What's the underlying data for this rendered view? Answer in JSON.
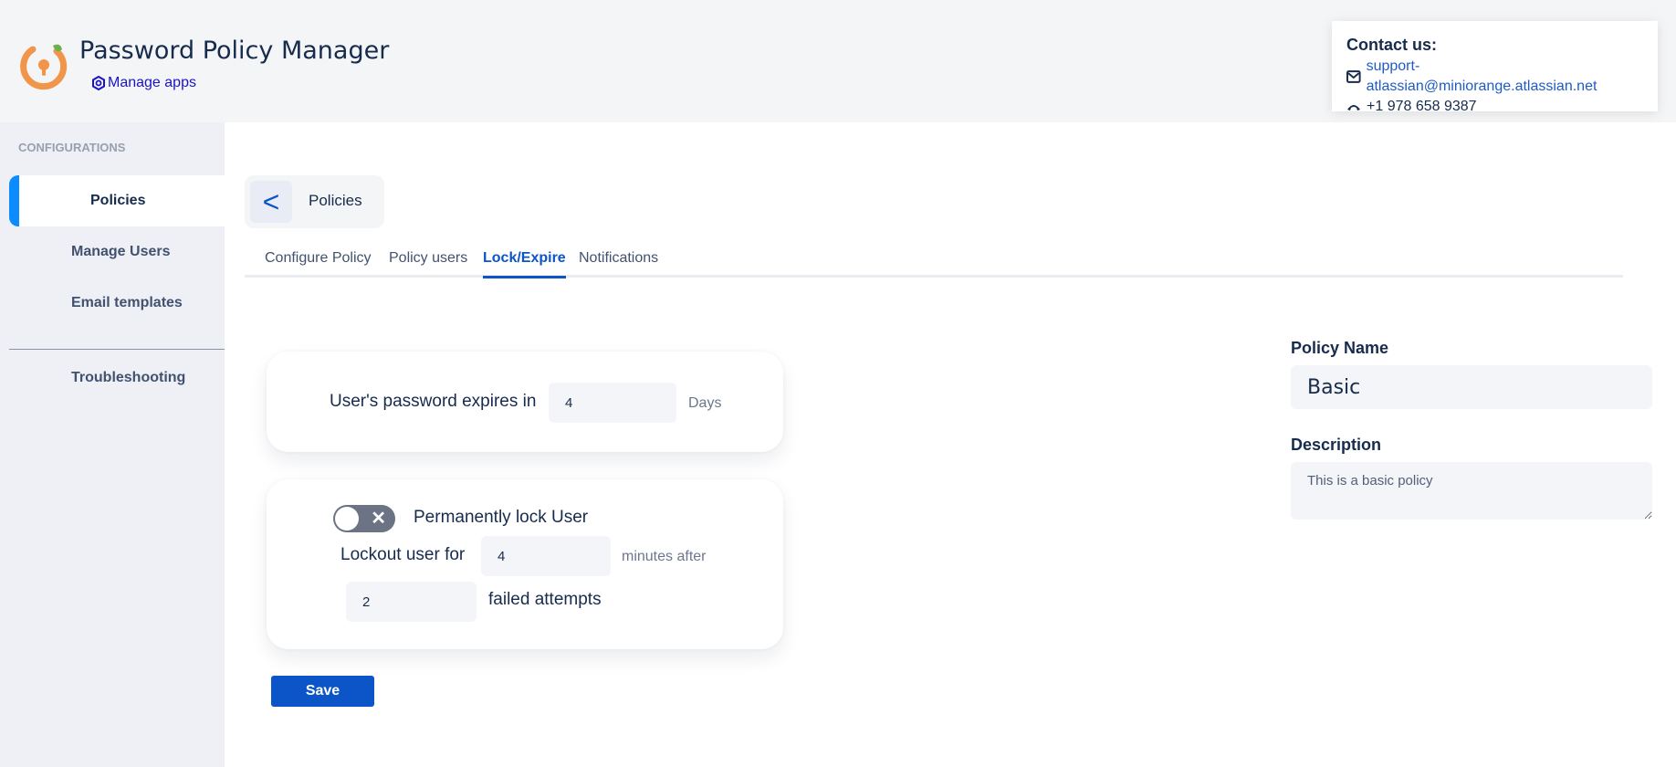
{
  "header": {
    "app_title": "Password Policy Manager",
    "manage_apps_label": "Manage apps",
    "contact": {
      "title": "Contact us:",
      "email": "support-atlassian@miniorange.atlassian.net",
      "phone": "+1 978 658 9387"
    }
  },
  "sidebar": {
    "section_label": "CONFIGURATIONS",
    "items": [
      {
        "label": "Policies",
        "active": true
      },
      {
        "label": "Manage Users"
      },
      {
        "label": "Email templates"
      },
      {
        "label": "Troubleshooting"
      }
    ]
  },
  "page": {
    "back_icon": "<",
    "title": "Policies",
    "tabs": [
      {
        "label": "Configure Policy"
      },
      {
        "label": "Policy users"
      },
      {
        "label": "Lock/Expire",
        "active": true
      },
      {
        "label": "Notifications"
      }
    ]
  },
  "expiry": {
    "label": "User's password expires in",
    "value": "4",
    "unit": "Days"
  },
  "lockout": {
    "toggle_label": "Permanently lock User",
    "toggle_on": false,
    "lockout_label": "Lockout user for",
    "minutes_value": "4",
    "minutes_suffix": "minutes after",
    "attempts_value": "2",
    "attempts_suffix": "failed attempts"
  },
  "save_label": "Save",
  "policy": {
    "name_label": "Policy Name",
    "name_value": "Basic",
    "description_label": "Description",
    "description_value": "This is a basic policy"
  },
  "colors": {
    "accent": "#0b55c8",
    "sidebar_active": "#0c8cff"
  }
}
